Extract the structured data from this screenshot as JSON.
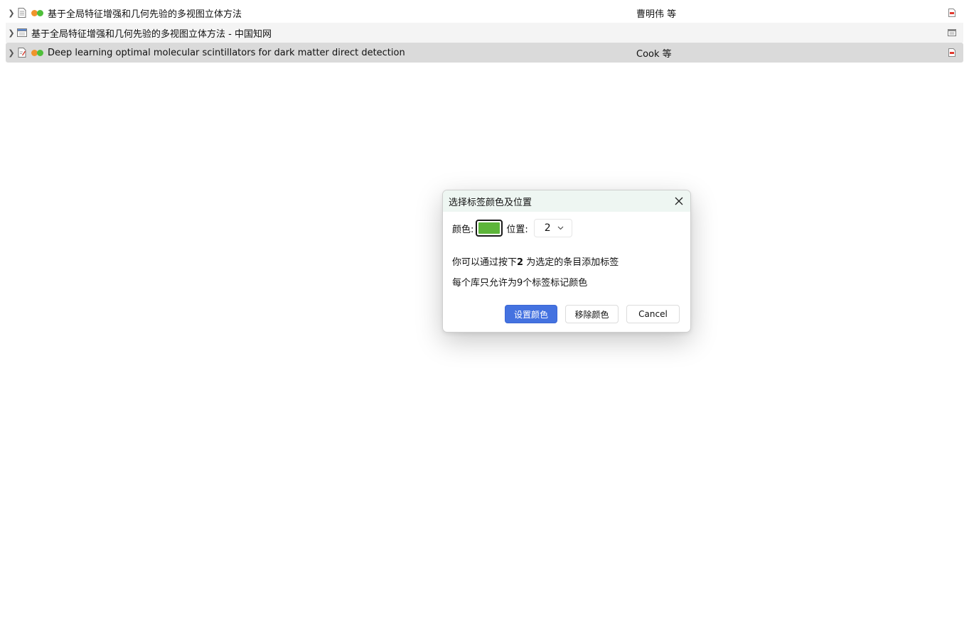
{
  "items": [
    {
      "title": "基于全局特征增强和几何先验的多视图立体方法",
      "creator": "曹明伟 等",
      "item_icon": "document-icon",
      "tags": [
        "#f0942b",
        "#4fbf3a"
      ],
      "attachment_icon": "pdf-icon",
      "state": "normal"
    },
    {
      "title": "基于全局特征增强和几何先验的多视图立体方法 - 中国知网",
      "creator": "",
      "item_icon": "webpage-icon",
      "tags": [],
      "attachment_icon": "snapshot-icon",
      "state": "alt"
    },
    {
      "title": "Deep learning optimal molecular scintillators for dark matter direct detection",
      "creator": "Cook 等",
      "item_icon": "preprint-icon",
      "tags": [
        "#f0942b",
        "#4fbf3a"
      ],
      "attachment_icon": "pdf-icon",
      "state": "selected"
    }
  ],
  "dialog": {
    "title": "选择标签颜色及位置",
    "color_label": "颜色:",
    "selected_color": "#5db53a",
    "position_label": "位置:",
    "position_value": "2",
    "info_prefix": "你可以通过按下",
    "info_key": "2",
    "info_suffix": " 为选定的条目添加标签",
    "info_limit": "每个库只允许为9个标签标记颜色",
    "set_button": "设置颜色",
    "remove_button": "移除颜色",
    "cancel_button": "Cancel"
  },
  "colors": {
    "primary_button": "#4472e0",
    "dialog_header": "#eef6f2",
    "selected_row": "#dadada",
    "alt_row": "#f4f4f4"
  }
}
